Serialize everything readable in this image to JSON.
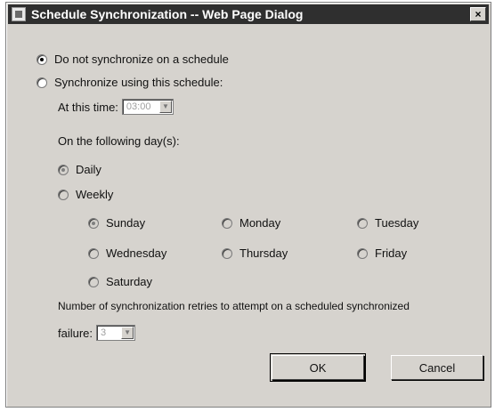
{
  "window": {
    "title": "Schedule Synchronization -- Web Page Dialog",
    "close_glyph": "×"
  },
  "schedule": {
    "no_schedule_label": "Do not synchronize on a schedule",
    "use_schedule_label": "Synchronize using this schedule:",
    "at_time_label": "At this time:",
    "time_value": "03:00",
    "following_days_label": "On the following day(s):",
    "daily_label": "Daily",
    "weekly_label": "Weekly",
    "days": {
      "sunday": "Sunday",
      "monday": "Monday",
      "tuesday": "Tuesday",
      "wednesday": "Wednesday",
      "thursday": "Thursday",
      "friday": "Friday",
      "saturday": "Saturday"
    },
    "retries_label_line1": "Number of synchronization retries to attempt on a scheduled synchronized",
    "retries_label_line2": "failure:",
    "retries_value": "3"
  },
  "buttons": {
    "ok": "OK",
    "cancel": "Cancel"
  }
}
